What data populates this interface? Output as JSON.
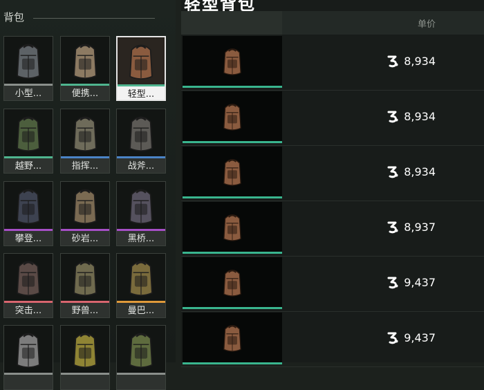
{
  "sidebar": {
    "title": "背包",
    "tiles": [
      {
        "name": "小型...",
        "accent": "#8a8f8b",
        "selected": false
      },
      {
        "name": "便携...",
        "accent": "#4fb58f",
        "selected": false
      },
      {
        "name": "轻型...",
        "accent": "#4fb58f",
        "selected": true
      },
      {
        "name": "越野...",
        "accent": "#4fb58f",
        "selected": false
      },
      {
        "name": "指挥...",
        "accent": "#4b84c7",
        "selected": false
      },
      {
        "name": "战斧...",
        "accent": "#4b84c7",
        "selected": false
      },
      {
        "name": "攀登...",
        "accent": "#a64fc6",
        "selected": false
      },
      {
        "name": "砂岩...",
        "accent": "#a64fc6",
        "selected": false
      },
      {
        "name": "黑桥...",
        "accent": "#a64fc6",
        "selected": false
      },
      {
        "name": "突击...",
        "accent": "#d8656f",
        "selected": false
      },
      {
        "name": "野兽...",
        "accent": "#d8656f",
        "selected": false
      },
      {
        "name": "曼巴...",
        "accent": "#e09a3a",
        "selected": false
      },
      {
        "name": "",
        "accent": "#8a8f8b",
        "selected": false
      },
      {
        "name": "",
        "accent": "#8a8f8b",
        "selected": false
      },
      {
        "name": "",
        "accent": "#8a8f8b",
        "selected": false
      }
    ]
  },
  "listing": {
    "title": "轻型背包",
    "column_price": "单价",
    "rows": [
      {
        "price": "8,934"
      },
      {
        "price": "8,934"
      },
      {
        "price": "8,934"
      },
      {
        "price": "8,937"
      },
      {
        "price": "9,437"
      },
      {
        "price": "9,437"
      }
    ]
  },
  "colors": {
    "accent_green": "#39b58e",
    "currency_icon": "#ffffff"
  }
}
